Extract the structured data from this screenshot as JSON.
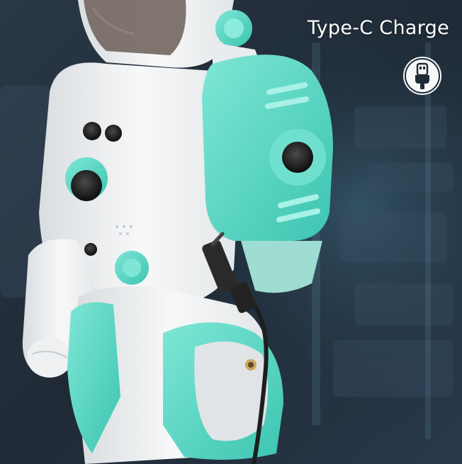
{
  "caption": {
    "text": "Type-C Charge"
  },
  "icons": {
    "charge": "usb-type-c-icon"
  },
  "colors": {
    "robot_shell": "#f4f6f7",
    "robot_accent": "#56d9c6",
    "cable": "#1e1e1e",
    "background": "#1c2733"
  }
}
